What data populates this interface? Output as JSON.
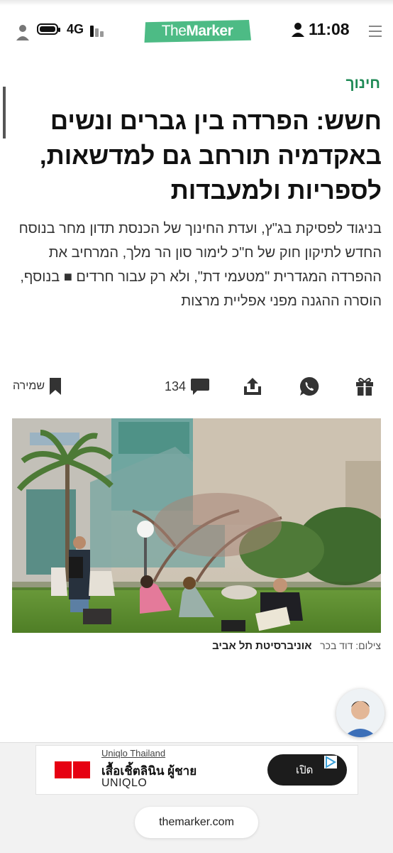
{
  "status_bar": {
    "network": "4G",
    "time": "11:08"
  },
  "header": {
    "logo_prefix": "The",
    "logo_bold": "Marker"
  },
  "article": {
    "section": "חינוך",
    "headline": "חשש: הפרדה בין גברים ונשים באקדמיה תורחב גם למדשאות, לספריות ולמעבדות",
    "subhead": "בניגוד לפסיקת בג\"ץ, ועדת החינוך של הכנסת תדון מחר בנוסח החדש לתיקון חוק של ח\"כ לימור סון הר מלך, המרחיב את ההפרדה המגדרית \"מטעמי דת\", ולא רק עבור חרדים ■ בנוסף, הוסרה ההגנה מפני אפליית מרצות"
  },
  "toolbar": {
    "comment_count": "134",
    "save_label": "שמירה"
  },
  "photo": {
    "caption_title": "אוניברסיטת תל אביב",
    "caption_credit": "צילום: דוד בכר"
  },
  "ad": {
    "brand_line": "Uniqlo Thailand",
    "title": "เสื้อเชิ้ตลินิน ผู้ชาย",
    "subtitle": "UNIQLO",
    "cta": "เปิด"
  },
  "browser": {
    "url": "themarker.com"
  },
  "colors": {
    "brand_green": "#4dbb85",
    "section_green": "#1e8a55",
    "uniqlo_red": "#e60012"
  }
}
